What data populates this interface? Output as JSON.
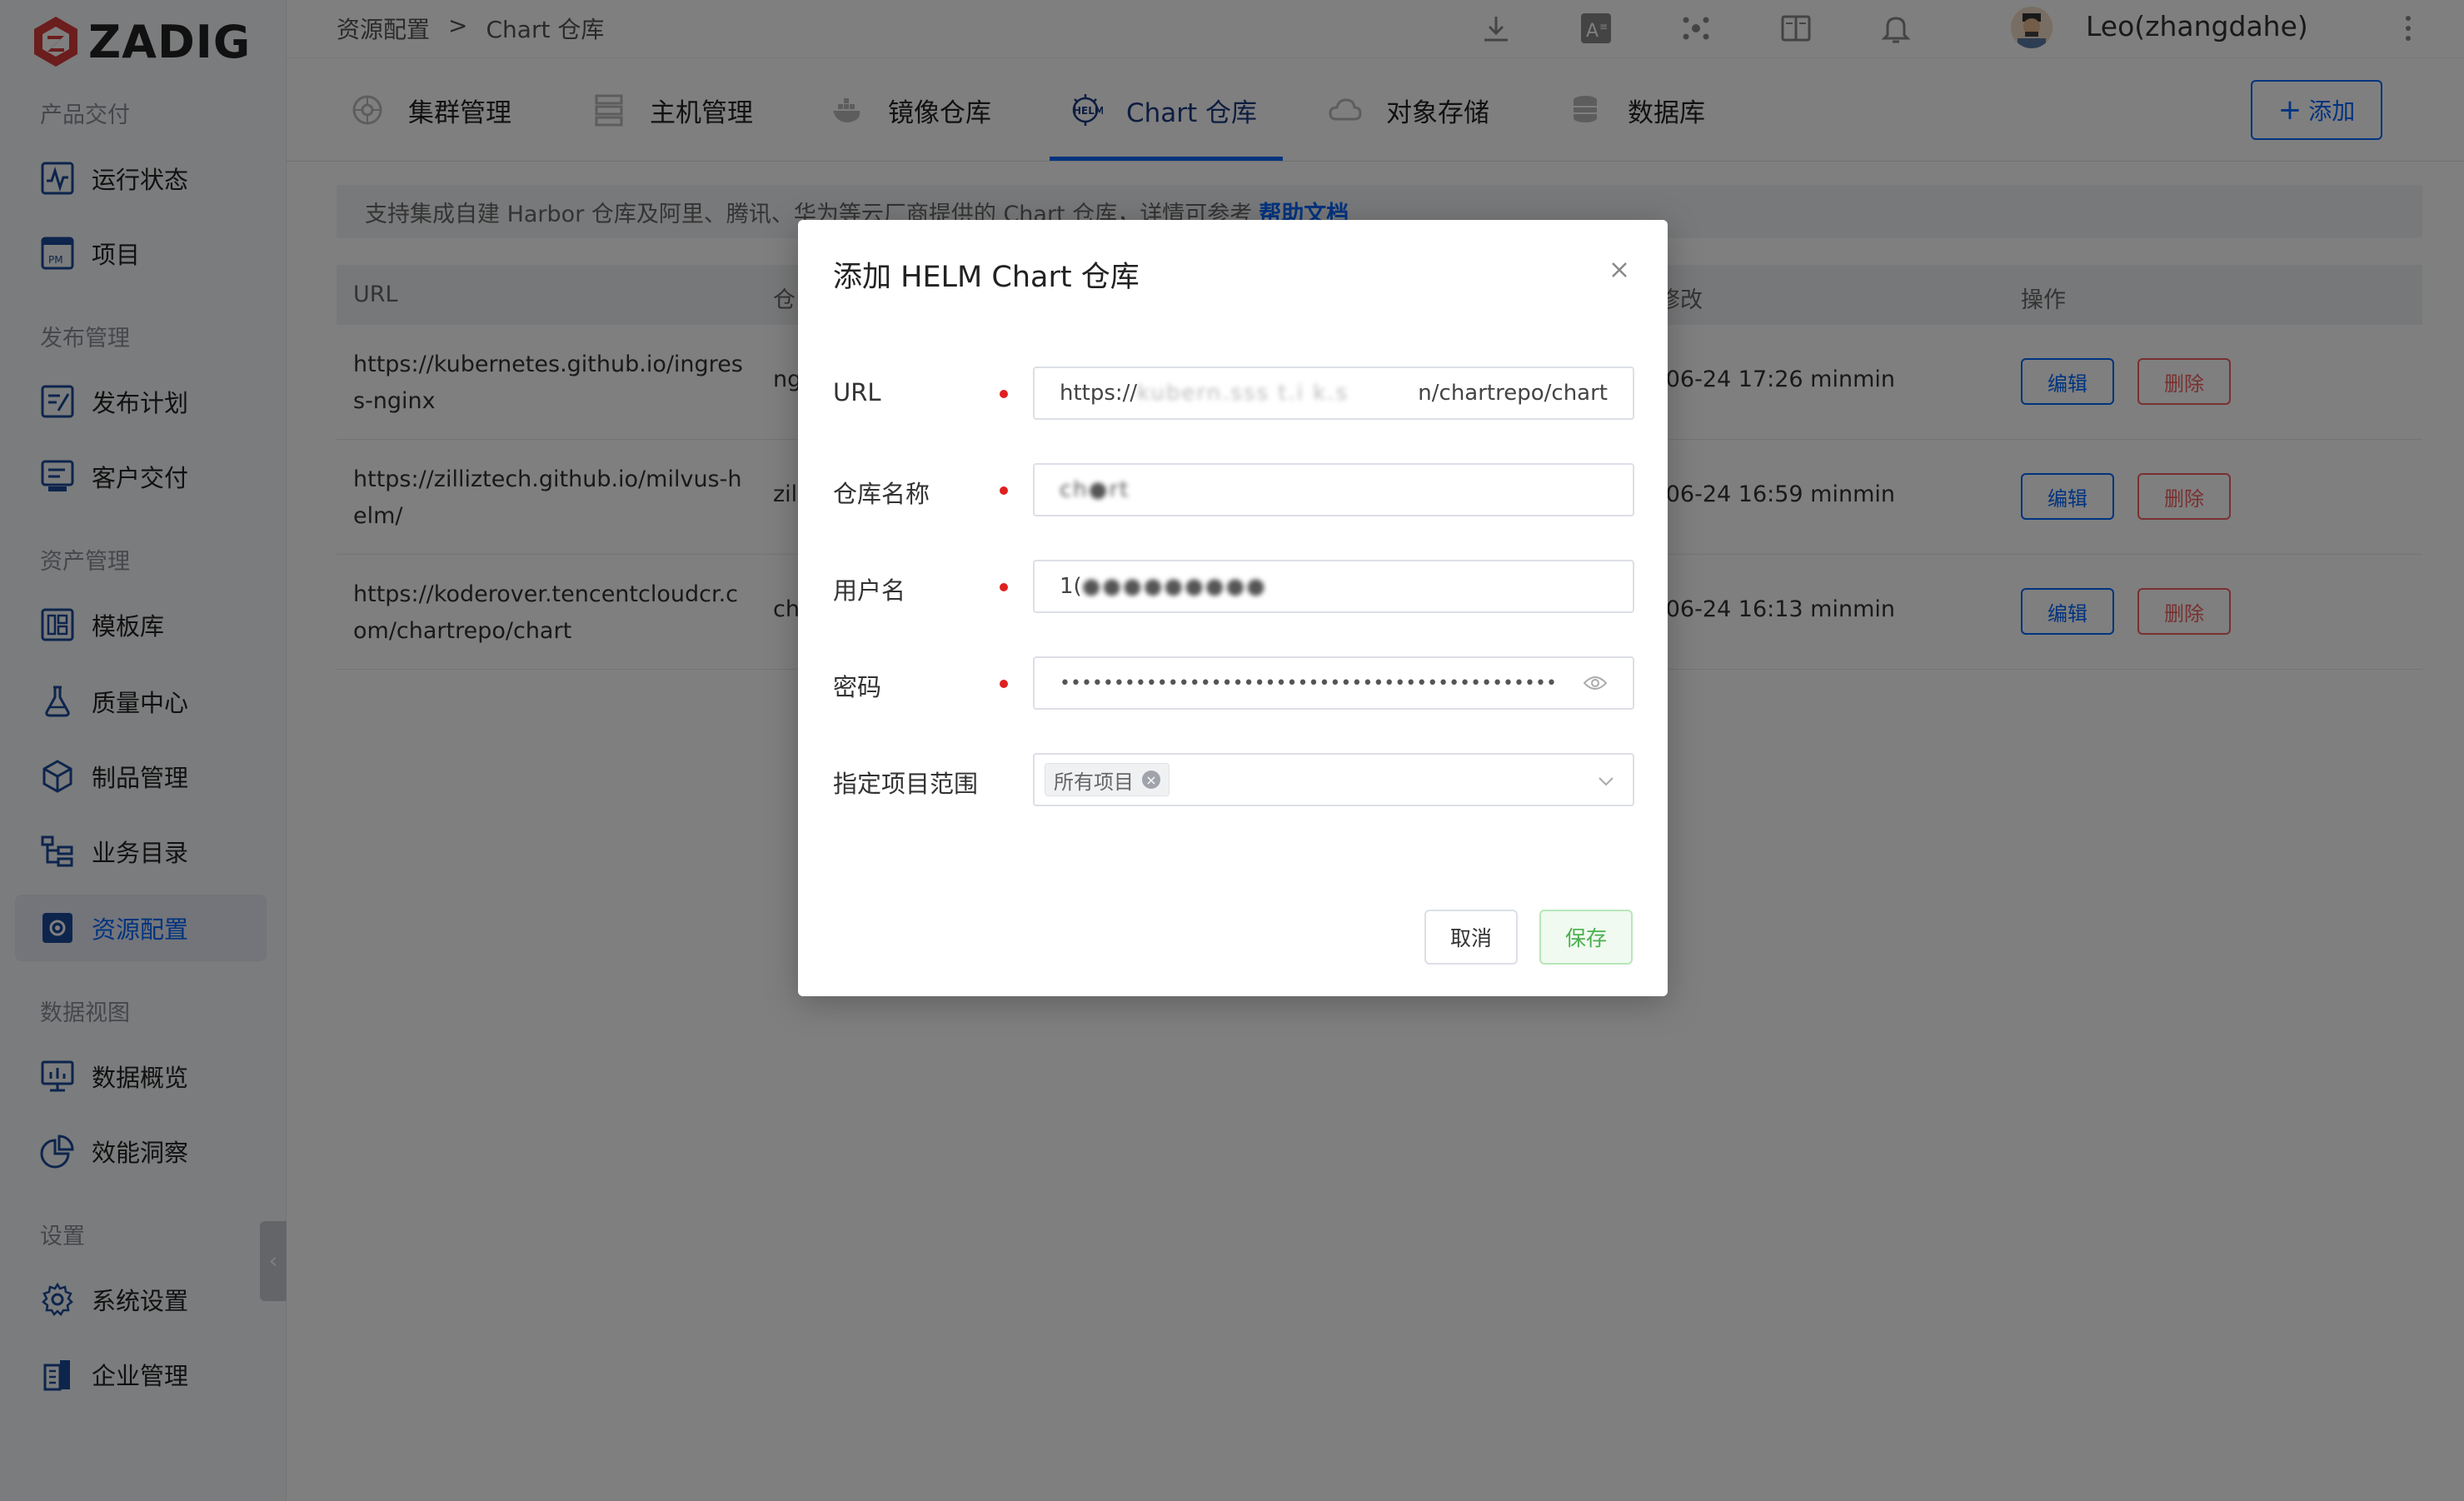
{
  "app": {
    "logo_text": "ZADIG",
    "accent": "#0066ff",
    "danger": "#f26060",
    "brand": "#d83a3a"
  },
  "sidebar": {
    "groups": [
      {
        "label": "产品交付",
        "items": [
          {
            "label": "运行状态",
            "icon": "pulse-icon"
          },
          {
            "label": "项目",
            "icon": "pm-icon"
          }
        ]
      },
      {
        "label": "发布管理",
        "items": [
          {
            "label": "发布计划",
            "icon": "plan-icon"
          },
          {
            "label": "客户交付",
            "icon": "delivery-icon"
          }
        ]
      },
      {
        "label": "资产管理",
        "items": [
          {
            "label": "模板库",
            "icon": "template-icon"
          },
          {
            "label": "质量中心",
            "icon": "flask-icon"
          },
          {
            "label": "制品管理",
            "icon": "package-icon"
          },
          {
            "label": "业务目录",
            "icon": "catalog-icon"
          },
          {
            "label": "资源配置",
            "icon": "resource-icon",
            "active": true
          }
        ]
      },
      {
        "label": "数据视图",
        "items": [
          {
            "label": "数据概览",
            "icon": "dashboard-icon"
          },
          {
            "label": "效能洞察",
            "icon": "pie-icon"
          }
        ]
      },
      {
        "label": "设置",
        "items": [
          {
            "label": "系统设置",
            "icon": "gear-icon"
          },
          {
            "label": "企业管理",
            "icon": "building-icon"
          }
        ]
      }
    ]
  },
  "header": {
    "breadcrumb": [
      "资源配置",
      ">",
      "Chart 仓库"
    ],
    "username": "Leo(zhangdahe)"
  },
  "tabs": {
    "items": [
      {
        "label": "集群管理",
        "icon": "cluster-icon"
      },
      {
        "label": "主机管理",
        "icon": "host-icon"
      },
      {
        "label": "镜像仓库",
        "icon": "docker-icon"
      },
      {
        "label": "Chart 仓库",
        "icon": "helm-icon",
        "active": true
      },
      {
        "label": "对象存储",
        "icon": "cloud-icon"
      },
      {
        "label": "数据库",
        "icon": "database-icon"
      }
    ],
    "add_label": "添加"
  },
  "notice": {
    "text": "支持集成自建 Harbor 仓库及阿里、腾讯、华为等云厂商提供的 Chart 仓库，详情可参考",
    "link": "帮助文档"
  },
  "table": {
    "headers": {
      "url": "URL",
      "name": "仓",
      "modified": "修改",
      "actions": "操作"
    },
    "rows": [
      {
        "url": "https://kubernetes.github.io/ingress-nginx",
        "name": "ng",
        "time": "-06-24 17:26 minmin"
      },
      {
        "url": "https://zilliztech.github.io/milvus-helm/",
        "name": "zil",
        "time": "-06-24 16:59 minmin"
      },
      {
        "url": "https://koderover.tencentcloudcr.com/chartrepo/chart",
        "name": "ch",
        "time": "-06-24 16:13 minmin"
      }
    ],
    "edit_label": "编辑",
    "delete_label": "删除"
  },
  "modal": {
    "title": "添加 HELM Chart 仓库",
    "fields": {
      "url": {
        "label": "URL",
        "value_prefix": "https://",
        "value_suffix": "n/chartrepo/chart"
      },
      "repo_name": {
        "label": "仓库名称"
      },
      "username": {
        "label": "用户名",
        "value_prefix": "1("
      },
      "password": {
        "label": "密码",
        "value": "••••••••••••••••••••••••••••••••••••••••••••••••••••••••••"
      },
      "scope": {
        "label": "指定项目范围",
        "tag": "所有项目"
      }
    },
    "cancel_label": "取消",
    "save_label": "保存"
  }
}
